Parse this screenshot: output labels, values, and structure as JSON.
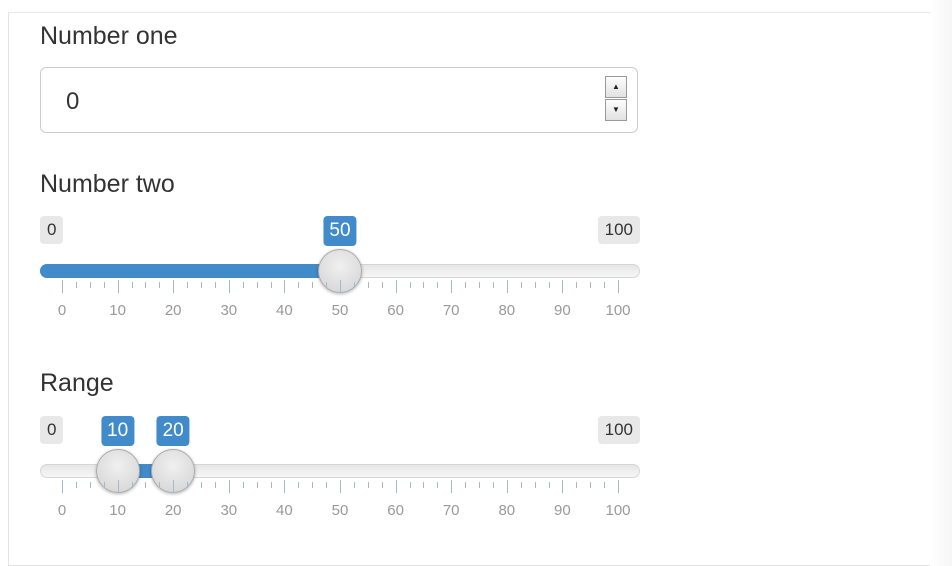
{
  "number_one": {
    "label": "Number one",
    "value": "0"
  },
  "number_two": {
    "label": "Number two",
    "min": 0,
    "max": 100,
    "value": 50,
    "min_label": "0",
    "max_label": "100",
    "value_label": "50",
    "tick_labels": [
      "0",
      "10",
      "20",
      "30",
      "40",
      "50",
      "60",
      "70",
      "80",
      "90",
      "100"
    ]
  },
  "range": {
    "label": "Range",
    "min": 0,
    "max": 100,
    "from": 10,
    "to": 20,
    "min_label": "0",
    "max_label": "100",
    "from_label": "10",
    "to_label": "20",
    "tick_labels": [
      "0",
      "10",
      "20",
      "30",
      "40",
      "50",
      "60",
      "70",
      "80",
      "90",
      "100"
    ]
  },
  "colors": {
    "accent": "#428bca",
    "tick": "#a9b8c6"
  }
}
